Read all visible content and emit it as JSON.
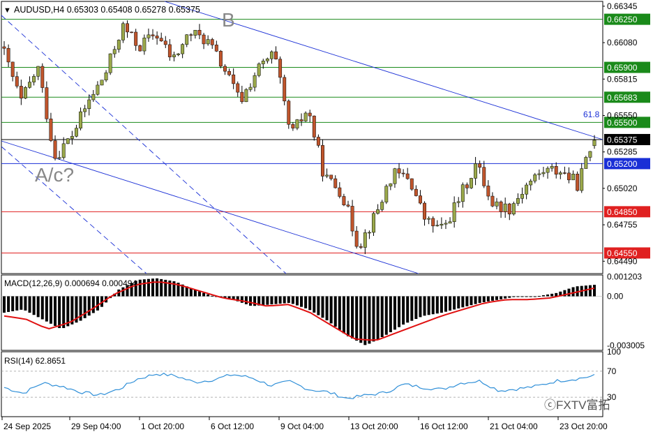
{
  "header": {
    "symbol_line": "AUDUSD,H4  0.65303 0.65408 0.65278 0.65375"
  },
  "watermark": "ⓒFXTV富拓",
  "colors": {
    "bull": "#9aa84a",
    "bear": "#c0552c",
    "support": "#e02020",
    "resistance": "#1a8a1a",
    "pivot_blue": "#1a2fd6",
    "macd_signal": "#e01010",
    "rsi": "#2f8fd8"
  },
  "chart_data": [
    {
      "type": "candlestick",
      "title": "AUDUSD,H4",
      "ohlc_header": {
        "open": 0.65303,
        "high": 0.65408,
        "low": 0.65278,
        "close": 0.65375
      },
      "ylim": [
        0.644,
        0.6638
      ],
      "y_ticks": [
        "0.66345",
        "0.66080",
        "0.65815",
        "0.65550",
        "0.65285",
        "0.65020",
        "0.64755",
        "0.64490"
      ],
      "x_ticks": [
        "24 Sep 2025",
        "29 Sep 04:00",
        "1 Oct 20:00",
        "6 Oct 12:00",
        "9 Oct 04:00",
        "13 Oct 20:00",
        "16 Oct 12:00",
        "21 Oct 04:00",
        "23 Oct 20:00"
      ],
      "levels": [
        {
          "value": 0.6625,
          "label": "0.66250",
          "kind": "resistance"
        },
        {
          "value": 0.659,
          "label": "0.65900",
          "kind": "resistance"
        },
        {
          "value": 0.65683,
          "label": "0.65683",
          "kind": "resistance"
        },
        {
          "value": 0.655,
          "label": "0.65500",
          "kind": "resistance"
        },
        {
          "value": 0.65375,
          "label": "0.65375",
          "kind": "price"
        },
        {
          "value": 0.652,
          "label": "0.65200",
          "kind": "pivot"
        },
        {
          "value": 0.6485,
          "label": "0.64850",
          "kind": "support"
        },
        {
          "value": 0.6455,
          "label": "0.64550",
          "kind": "support"
        }
      ],
      "annotations": [
        "B",
        "A/c?",
        "61.8"
      ],
      "waypoints": [
        [
          0.6605,
          0.6615,
          0.6595,
          0.66
        ],
        [
          0.6585,
          0.6592,
          0.656,
          0.6565
        ],
        [
          0.6585,
          0.6598,
          0.6578,
          0.659
        ],
        [
          0.653,
          0.6535,
          0.652,
          0.6525
        ],
        [
          0.6538,
          0.6546,
          0.653,
          0.654
        ],
        [
          0.656,
          0.657,
          0.6555,
          0.6565
        ],
        [
          0.658,
          0.659,
          0.6572,
          0.6585
        ],
        [
          0.6615,
          0.663,
          0.6605,
          0.662
        ],
        [
          0.661,
          0.6625,
          0.6595,
          0.6605
        ],
        [
          0.662,
          0.6632,
          0.661,
          0.6615
        ],
        [
          0.66,
          0.6615,
          0.659,
          0.6595
        ],
        [
          0.661,
          0.6622,
          0.66,
          0.6615
        ],
        [
          0.6618,
          0.663,
          0.6605,
          0.661
        ],
        [
          0.6605,
          0.6612,
          0.6585,
          0.659
        ],
        [
          0.6572,
          0.658,
          0.656,
          0.6565
        ],
        [
          0.6585,
          0.6592,
          0.6578,
          0.6588
        ],
        [
          0.6605,
          0.6612,
          0.6595,
          0.66
        ],
        [
          0.655,
          0.656,
          0.6535,
          0.654
        ],
        [
          0.6565,
          0.657,
          0.6555,
          0.656
        ],
        [
          0.65,
          0.6525,
          0.649,
          0.651
        ],
        [
          0.6505,
          0.6518,
          0.6495,
          0.65
        ],
        [
          0.6495,
          0.6505,
          0.6445,
          0.646
        ],
        [
          0.6485,
          0.649,
          0.6478,
          0.6482
        ],
        [
          0.6515,
          0.6522,
          0.6505,
          0.6512
        ],
        [
          0.6508,
          0.6518,
          0.65,
          0.651
        ],
        [
          0.6475,
          0.6482,
          0.647,
          0.6478
        ],
        [
          0.647,
          0.6478,
          0.6465,
          0.6472
        ],
        [
          0.649,
          0.6498,
          0.6485,
          0.6495
        ],
        [
          0.6515,
          0.6523,
          0.6508,
          0.652
        ],
        [
          0.6495,
          0.6503,
          0.6488,
          0.649
        ],
        [
          0.649,
          0.6498,
          0.6485,
          0.6488
        ],
        [
          0.6495,
          0.6508,
          0.649,
          0.6505
        ],
        [
          0.652,
          0.6528,
          0.651,
          0.6515
        ],
        [
          0.651,
          0.652,
          0.6505,
          0.6515
        ],
        [
          0.65,
          0.6508,
          0.6493,
          0.6505
        ],
        [
          0.6533,
          0.6541,
          0.6525,
          0.6537
        ]
      ]
    },
    {
      "type": "histogram",
      "title": "MACD(12,26,9) 0.000694 0.000494",
      "ylim": [
        -0.0033,
        0.0013
      ],
      "y_ticks": [
        "0.001203",
        "0.00",
        "-0.003005"
      ],
      "hist_waypoints": [
        -0.001,
        -0.0008,
        -0.0014,
        -0.002,
        -0.0015,
        -0.0008,
        0.0004,
        0.001,
        0.0011,
        0.0009,
        0.0004,
        0.0,
        -0.0002,
        -0.0006,
        -0.0005,
        -0.0004,
        -0.0008,
        -0.0015,
        -0.0024,
        -0.003,
        -0.0024,
        -0.0017,
        -0.0012,
        -0.001,
        -0.0007,
        -0.0004,
        -0.0002,
        0.0,
        0.0,
        0.0002,
        0.0006,
        0.0007
      ],
      "signal_waypoints": [
        -0.0012,
        -0.0014,
        -0.002,
        -0.0016,
        -0.0008,
        0.0001,
        0.0007,
        0.0009,
        0.0007,
        0.0003,
        -0.0001,
        -0.0003,
        -0.0006,
        -0.0005,
        -0.001,
        -0.0018,
        -0.0026,
        -0.0027,
        -0.0022,
        -0.0017,
        -0.0012,
        -0.0008,
        -0.0004,
        -0.0002,
        -0.0002,
        -0.0001,
        0.0002,
        0.0005
      ]
    },
    {
      "type": "line",
      "title": "RSI(14) 62.8651",
      "ylim": [
        0,
        100
      ],
      "y_ticks": [
        "100",
        "70",
        "30",
        "0"
      ],
      "levels": [
        70,
        30
      ],
      "waypoints": [
        45,
        36,
        52,
        47,
        38,
        33,
        42,
        58,
        66,
        63,
        53,
        57,
        65,
        60,
        48,
        54,
        42,
        38,
        28,
        33,
        37,
        50,
        45,
        42,
        52,
        55,
        40,
        43,
        47,
        55,
        58,
        63
      ]
    }
  ]
}
